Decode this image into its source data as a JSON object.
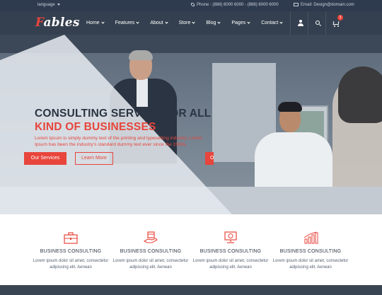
{
  "topbar": {
    "language": "language",
    "phone": "Phone : (888) 6000 6000 - (888) 6000 6000",
    "email": "Email: Design@domain.com"
  },
  "header": {
    "logo_first": "F",
    "logo_rest": "ables",
    "nav": {
      "home": "Home",
      "features": "Features",
      "about": "About",
      "store": "Store",
      "blog": "Blog",
      "pages": "Pages",
      "contact": "Contact"
    },
    "cart_count": "3"
  },
  "hero": {
    "title_line1": "CONSULTING SERVICE FOR ALL",
    "title_line2": "KIND OF BUSINESSES",
    "text": "Lorem Ipsum is simply dummy text of the printing and typesetting industry. Lorem Ipsum has been the industry's standard dummy text ever since the 1500s.",
    "btn_primary": "Our Services",
    "btn_secondary": "Learn More",
    "btn_right": "O"
  },
  "services": [
    {
      "icon": "briefcase-icon",
      "title": "BUSINESS CONSULTING",
      "desc": "Lorem ipsum dolor sit amet, consectetur adipiscing elit. Aenean"
    },
    {
      "icon": "hand-box-icon",
      "title": "BUSINESS CONSULTING",
      "desc": "Lorem ipsum dolor sit amet, consectetur adipiscing elit. Aenean"
    },
    {
      "icon": "monitor-dollar-icon",
      "title": "BUSINESS CONSULTING",
      "desc": "Lorem ipsum dolor sit amet, consectetur adipiscing elit. Aenean"
    },
    {
      "icon": "bar-chart-icon",
      "title": "BUSINESS CONSULTING",
      "desc": "Lorem ipsum dolor sit amet, consectetur adipiscing elit. Aenean"
    }
  ],
  "colors": {
    "accent": "#e8453c",
    "topbar": "#2e3b4e",
    "header": "#34404f",
    "dark_text": "#2a3442"
  }
}
